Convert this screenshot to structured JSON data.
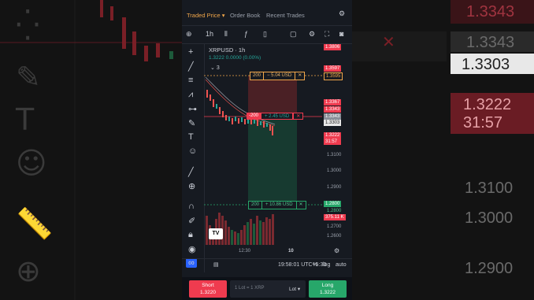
{
  "background": {
    "prices": [
      "1.3343",
      "1.3303",
      "1.3222",
      "31:57",
      "1.3100",
      "1.3000",
      "1.2900"
    ],
    "ghost_tools": [
      "crosshair-icon",
      "brush-icon",
      "text-icon",
      "emoji-icon",
      "ruler-icon",
      "zoom-in-icon"
    ]
  },
  "tabs": [
    {
      "label": "Traded Price",
      "active": true
    },
    {
      "label": "Order Book",
      "active": false
    },
    {
      "label": "Recent Trades",
      "active": false
    }
  ],
  "toolbar": {
    "interval": "1h"
  },
  "chart": {
    "symbol": "XRPUSD · 1h",
    "ohlc_line": "1.3222 0.0000 (0.00%)",
    "indicators_count": "3",
    "take_profit": {
      "qty": "200",
      "pnl": "− 5.04 USD"
    },
    "position": {
      "qty": "-200",
      "pnl": "+ 2.45 USD"
    },
    "stop_loss": {
      "qty": "200",
      "pnl": "+ 10.86 USD"
    },
    "x_labels": [
      "12:30",
      "10"
    ],
    "volume_label": "375.11 K"
  },
  "axis": {
    "labels": [
      "1.3806",
      "1.3597",
      "1.3595",
      "1.3367",
      "1.3343",
      "1.3343",
      "1.3303",
      "1.3222",
      "31:57",
      "1.3100",
      "1.3000",
      "1.2900",
      "1.2800",
      "1.2800",
      "1.2700",
      "1.2600"
    ]
  },
  "bottom": {
    "time": "19:58:01 UTC+5:30",
    "percent": "%",
    "log": "log",
    "auto": "auto"
  },
  "trade": {
    "short_label": "Short",
    "short_price": "1.3220",
    "lot_placeholder": "1 Lot = 1 XRP",
    "lot_label": "Lot",
    "long_label": "Long",
    "long_price": "1.3222"
  },
  "colors": {
    "up": "#26a69a",
    "down": "#ef5350",
    "accent": "#f0a64a",
    "red": "#ef3b4f",
    "green": "#27a76a"
  }
}
